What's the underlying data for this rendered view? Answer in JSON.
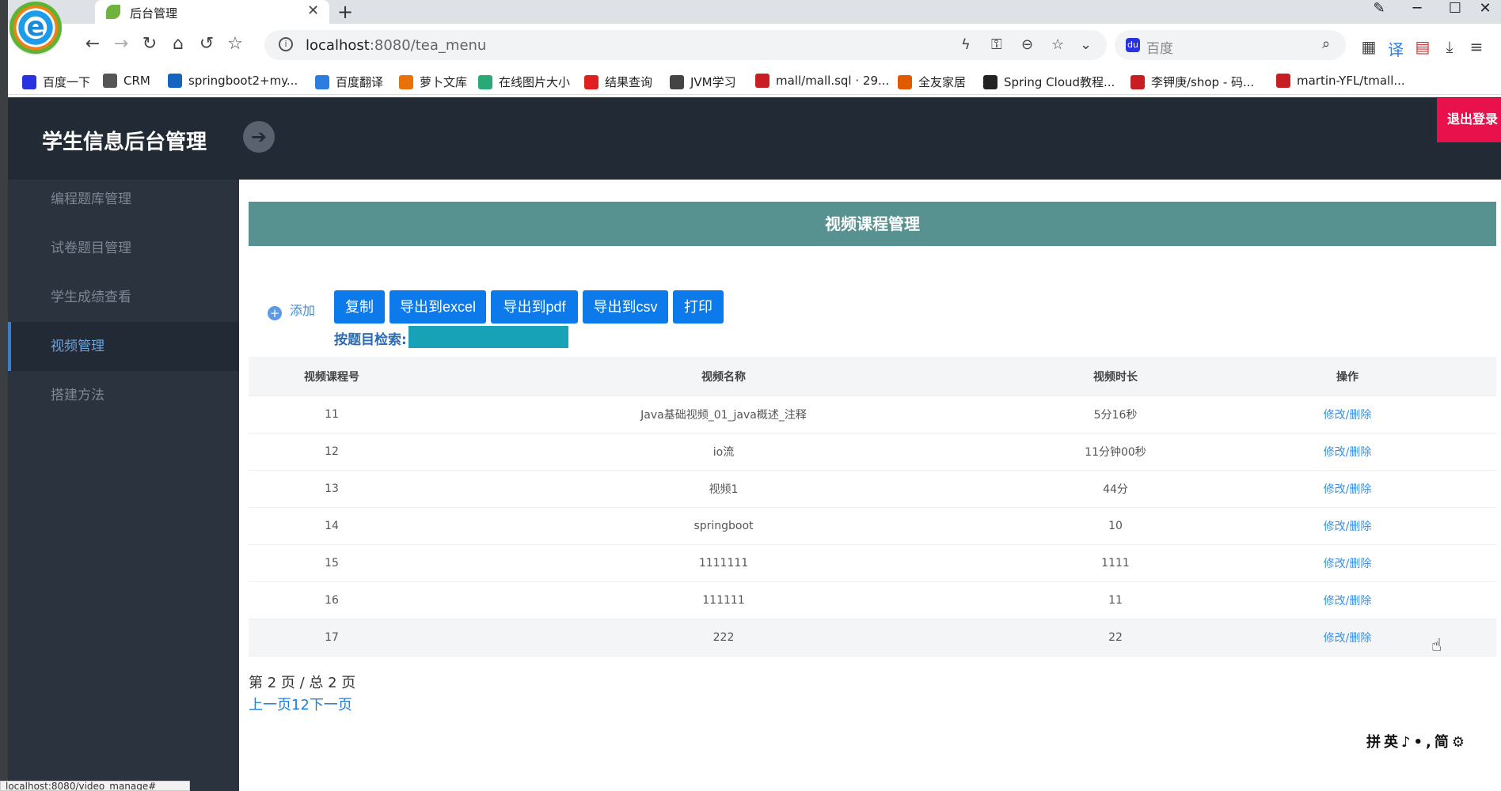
{
  "browser": {
    "tab_title": "后台管理",
    "tab_close": "✕",
    "new_tab": "+",
    "url_host": "localhost",
    "url_rest": ":8080/tea_menu",
    "search_placeholder": "百度",
    "logo_letter": "e"
  },
  "bookmarks": [
    {
      "label": "百度一下",
      "color": "#2932e1"
    },
    {
      "label": "CRM",
      "color": "#555555"
    },
    {
      "label": "springboot2+my...",
      "color": "#1565c0"
    },
    {
      "label": "百度翻译",
      "color": "#2d7de0"
    },
    {
      "label": "萝卜文库",
      "color": "#e8710a"
    },
    {
      "label": "在线图片大小",
      "color": "#2aa876"
    },
    {
      "label": "结果查询",
      "color": "#e02020"
    },
    {
      "label": "JVM学习",
      "color": "#444444"
    },
    {
      "label": "mall/mall.sql · 29...",
      "color": "#c71d23"
    },
    {
      "label": "全友家居",
      "color": "#e05a00"
    },
    {
      "label": "Spring Cloud教程...",
      "color": "#222222"
    },
    {
      "label": "李钾庚/shop - 码...",
      "color": "#c71d23"
    },
    {
      "label": "martin-YFL/tmall...",
      "color": "#c71d23"
    }
  ],
  "header": {
    "title": "学生信息后台管理",
    "toggle_icon": "➔",
    "logout": "退出登录"
  },
  "sidebar": {
    "items": [
      {
        "label": "编程题库管理",
        "active": false
      },
      {
        "label": "试卷题目管理",
        "active": false
      },
      {
        "label": "学生成绩查看",
        "active": false
      },
      {
        "label": "视频管理",
        "active": true
      },
      {
        "label": "搭建方法",
        "active": false
      }
    ]
  },
  "main": {
    "panel_title": "视频课程管理",
    "add_label": "添加",
    "toolbar": [
      "复制",
      "导出到excel",
      "导出到pdf",
      "导出到csv",
      "打印"
    ],
    "search_label": "按题目检索:",
    "search_value": "",
    "columns": [
      "视频课程号",
      "视频名称",
      "视频时长",
      "操作"
    ],
    "rows": [
      {
        "id": "11",
        "name": "Java基础视频_01_java概述_注释",
        "duration": "5分16秒",
        "op": "修改/删除"
      },
      {
        "id": "12",
        "name": "io流",
        "duration": "11分钟00秒",
        "op": "修改/删除"
      },
      {
        "id": "13",
        "name": "视频1",
        "duration": "44分",
        "op": "修改/删除"
      },
      {
        "id": "14",
        "name": "springboot",
        "duration": "10",
        "op": "修改/删除"
      },
      {
        "id": "15",
        "name": "1111111",
        "duration": "1111",
        "op": "修改/删除"
      },
      {
        "id": "16",
        "name": "111111",
        "duration": "11",
        "op": "修改/删除"
      },
      {
        "id": "17",
        "name": "222",
        "duration": "22",
        "op": "修改/删除"
      }
    ],
    "page_info": "第 2 页 / 总 2 页",
    "pager": {
      "prev": "上一页",
      "p1": "1",
      "p2": "2",
      "next": "下一页"
    }
  },
  "status_bar_url": "localhost:8080/video_manage#",
  "ime_bar": "拼英♪•,简⚙"
}
